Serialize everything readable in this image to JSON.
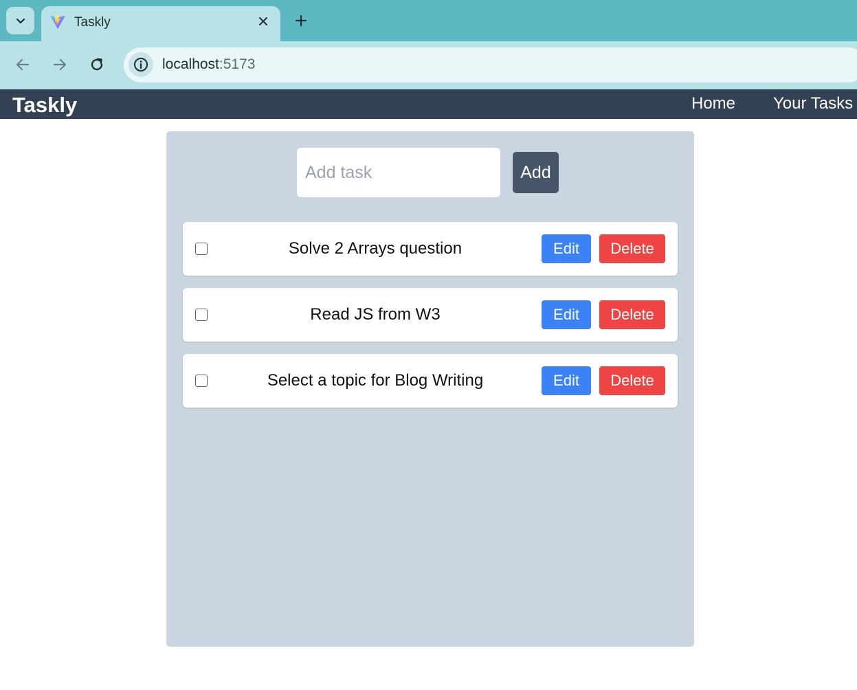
{
  "browser": {
    "tab_title": "Taskly",
    "favicon": "vite-logo-icon",
    "url_host": "localhost",
    "url_port": ":5173"
  },
  "navbar": {
    "brand": "Taskly",
    "links": [
      "Home",
      "Your Tasks"
    ]
  },
  "composer": {
    "placeholder": "Add task",
    "value": "",
    "add_label": "Add"
  },
  "tasks": [
    {
      "text": "Solve 2 Arrays question",
      "done": false,
      "edit_label": "Edit",
      "delete_label": "Delete"
    },
    {
      "text": "Read JS from W3",
      "done": false,
      "edit_label": "Edit",
      "delete_label": "Delete"
    },
    {
      "text": "Select a topic for Blog Writing",
      "done": false,
      "edit_label": "Edit",
      "delete_label": "Delete"
    }
  ],
  "colors": {
    "tabstrip": "#5db9c1",
    "toolbar": "#b9e2e6",
    "navbar": "#334155",
    "panel": "#cbd5e1",
    "add_button": "#475569",
    "edit_button": "#3b82f6",
    "delete_button": "#ef4444"
  }
}
